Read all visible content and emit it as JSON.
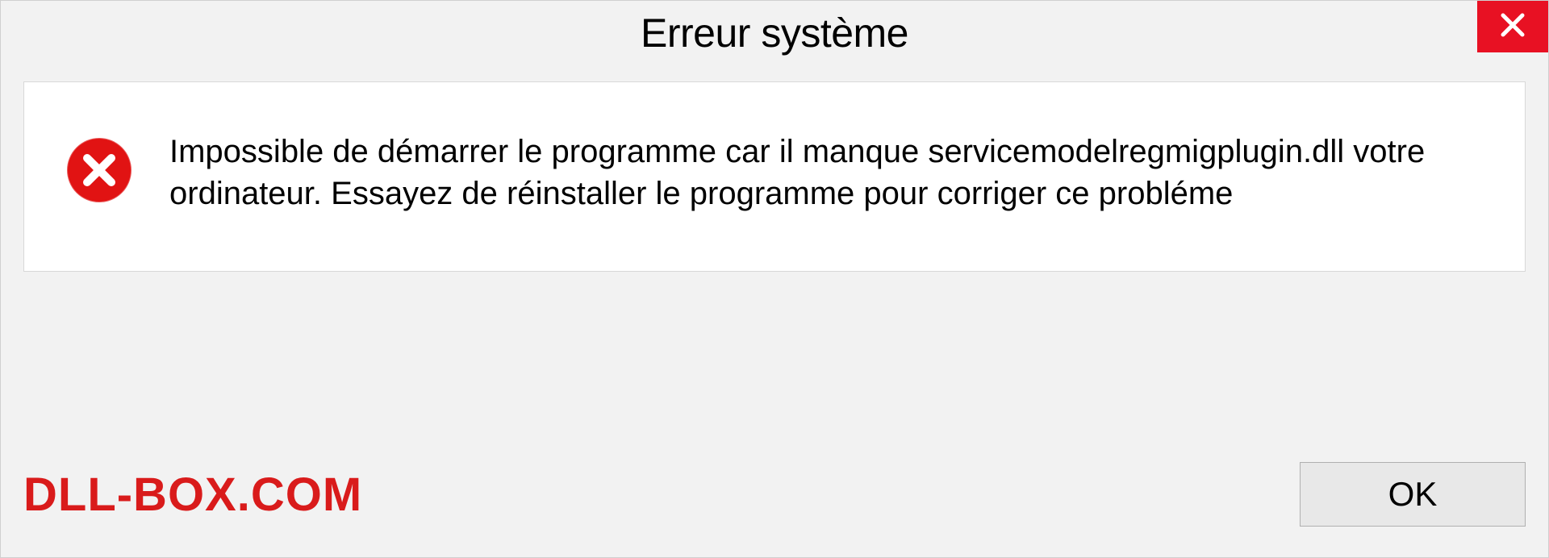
{
  "dialog": {
    "title": "Erreur système",
    "message": "Impossible de démarrer le programme car il manque servicemodelregmigplugin.dll votre ordinateur. Essayez de réinstaller le programme pour corriger ce probléme",
    "ok_label": "OK"
  },
  "watermark": "DLL-BOX.COM",
  "colors": {
    "close_bg": "#e81123",
    "error_icon": "#e11313",
    "watermark": "#d91b1b"
  }
}
